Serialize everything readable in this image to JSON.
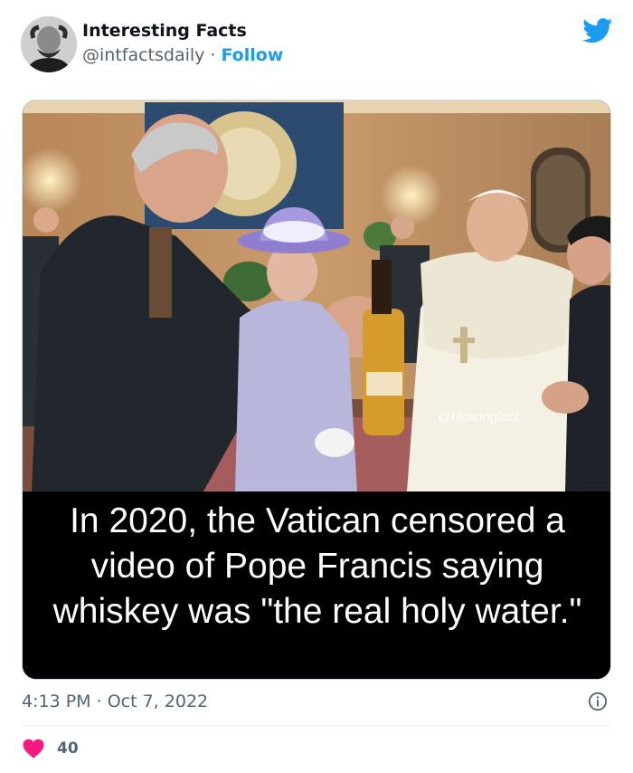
{
  "author": {
    "name": "Interesting Facts",
    "handle": "@intfactsdaily",
    "separator": "·",
    "follow_label": "Follow"
  },
  "media": {
    "caption": "In 2020, the Vatican censored a video of Pope Francis saying whiskey was \"the real holy water.\"",
    "watermark": "@blowingfact"
  },
  "footer": {
    "time": "4:13 PM",
    "separator": "·",
    "date": "Oct 7, 2022",
    "likes": "40"
  },
  "icons": {
    "brand": "twitter-bird-icon",
    "info": "info-icon",
    "like": "heart-icon"
  },
  "colors": {
    "accent": "#1d9bf0",
    "like": "#f91880",
    "muted": "#536471"
  }
}
